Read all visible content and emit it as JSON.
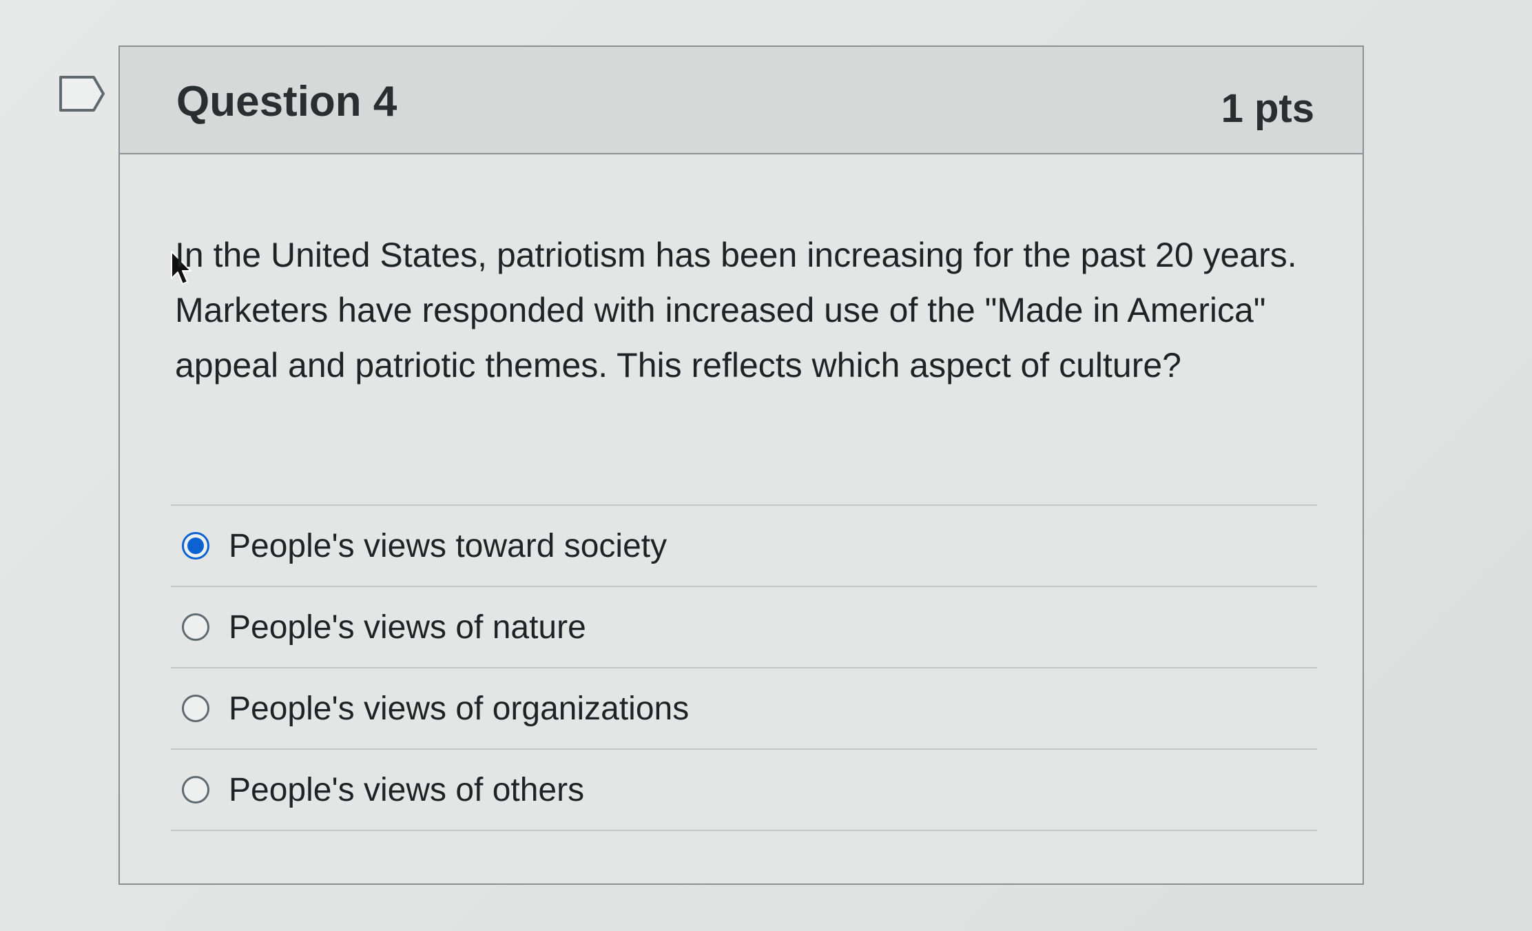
{
  "question": {
    "title": "Question 4",
    "points": "1 pts",
    "text": "In the United States, patriotism has been increasing for the past 20 years. Marketers have responded with increased use of the \"Made in America\" appeal and patriotic themes. This reflects which aspect of culture?"
  },
  "answers": [
    {
      "label": "People's views toward society",
      "selected": true
    },
    {
      "label": "People's views of nature",
      "selected": false
    },
    {
      "label": "People's views of organizations",
      "selected": false
    },
    {
      "label": "People's views of others",
      "selected": false
    }
  ],
  "icons": {
    "flag": "bookmark-flag-icon",
    "cursor": "mouse-pointer-icon"
  },
  "colors": {
    "selected_radio": "#0b63d1"
  }
}
